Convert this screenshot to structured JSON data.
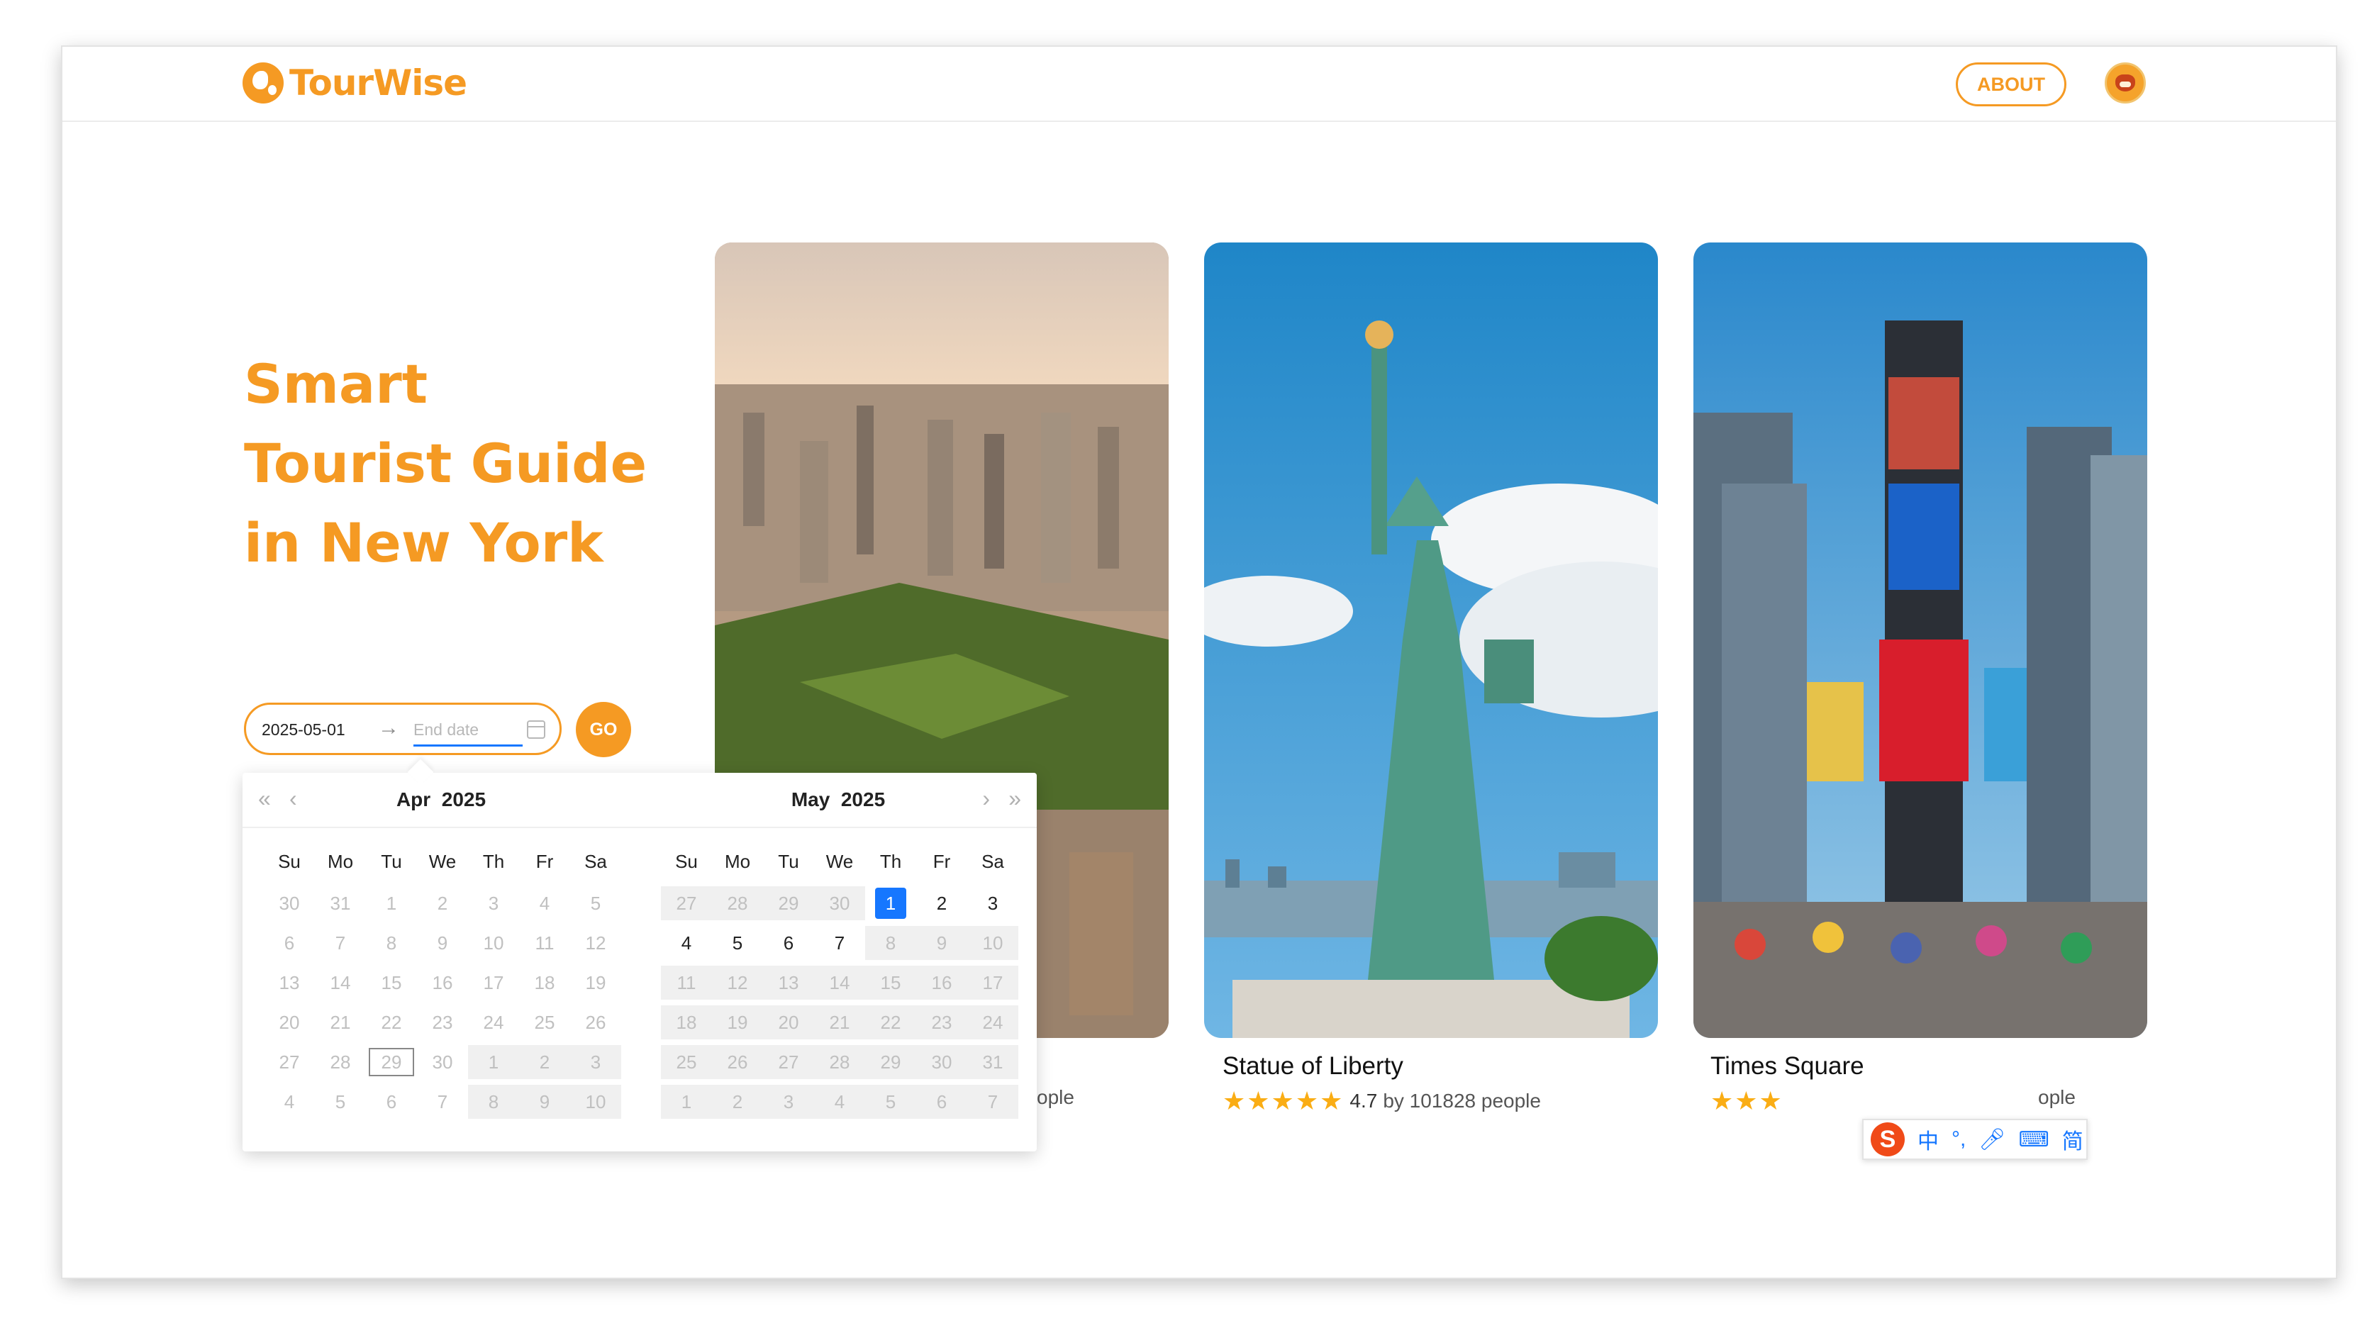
{
  "header": {
    "brand": "TourWise",
    "about_label": "ABOUT"
  },
  "hero": {
    "title_lines": [
      "Smart",
      "Tourist Guide",
      "in New York"
    ]
  },
  "date_range": {
    "start_value": "2025-05-01",
    "end_placeholder": "End date",
    "go_label": "GO"
  },
  "calendar": {
    "weekdays": [
      "Su",
      "Mo",
      "Tu",
      "We",
      "Th",
      "Fr",
      "Sa"
    ],
    "left": {
      "month": "Apr",
      "year": "2025",
      "weeks": [
        [
          "30",
          "31",
          "1",
          "2",
          "3",
          "4",
          "5"
        ],
        [
          "6",
          "7",
          "8",
          "9",
          "10",
          "11",
          "12"
        ],
        [
          "13",
          "14",
          "15",
          "16",
          "17",
          "18",
          "19"
        ],
        [
          "20",
          "21",
          "22",
          "23",
          "24",
          "25",
          "26"
        ],
        [
          "27",
          "28",
          "29",
          "30",
          "1",
          "2",
          "3"
        ],
        [
          "4",
          "5",
          "6",
          "7",
          "8",
          "9",
          "10"
        ]
      ],
      "today": "29"
    },
    "right": {
      "month": "May",
      "year": "2025",
      "weeks": [
        [
          "27",
          "28",
          "29",
          "30",
          "1",
          "2",
          "3"
        ],
        [
          "4",
          "5",
          "6",
          "7",
          "8",
          "9",
          "10"
        ],
        [
          "11",
          "12",
          "13",
          "14",
          "15",
          "16",
          "17"
        ],
        [
          "18",
          "19",
          "20",
          "21",
          "22",
          "23",
          "24"
        ],
        [
          "25",
          "26",
          "27",
          "28",
          "29",
          "30",
          "31"
        ],
        [
          "1",
          "2",
          "3",
          "4",
          "5",
          "6",
          "7"
        ]
      ],
      "selected": "1"
    }
  },
  "attractions": [
    {
      "title": "",
      "rating": "",
      "people_suffix": "ople"
    },
    {
      "title": "Statue of Liberty",
      "rating": "4.7",
      "people_text": "by 101828 people"
    },
    {
      "title": "Times Square",
      "people_suffix": "ople"
    }
  ],
  "ime": {
    "logo": "S",
    "items": [
      "中",
      "°,",
      "mic-icon",
      "keyboard-icon",
      "简"
    ]
  },
  "colors": {
    "accent": "#f59a23",
    "selected_blue": "#1677ff",
    "star": "#faad14"
  }
}
